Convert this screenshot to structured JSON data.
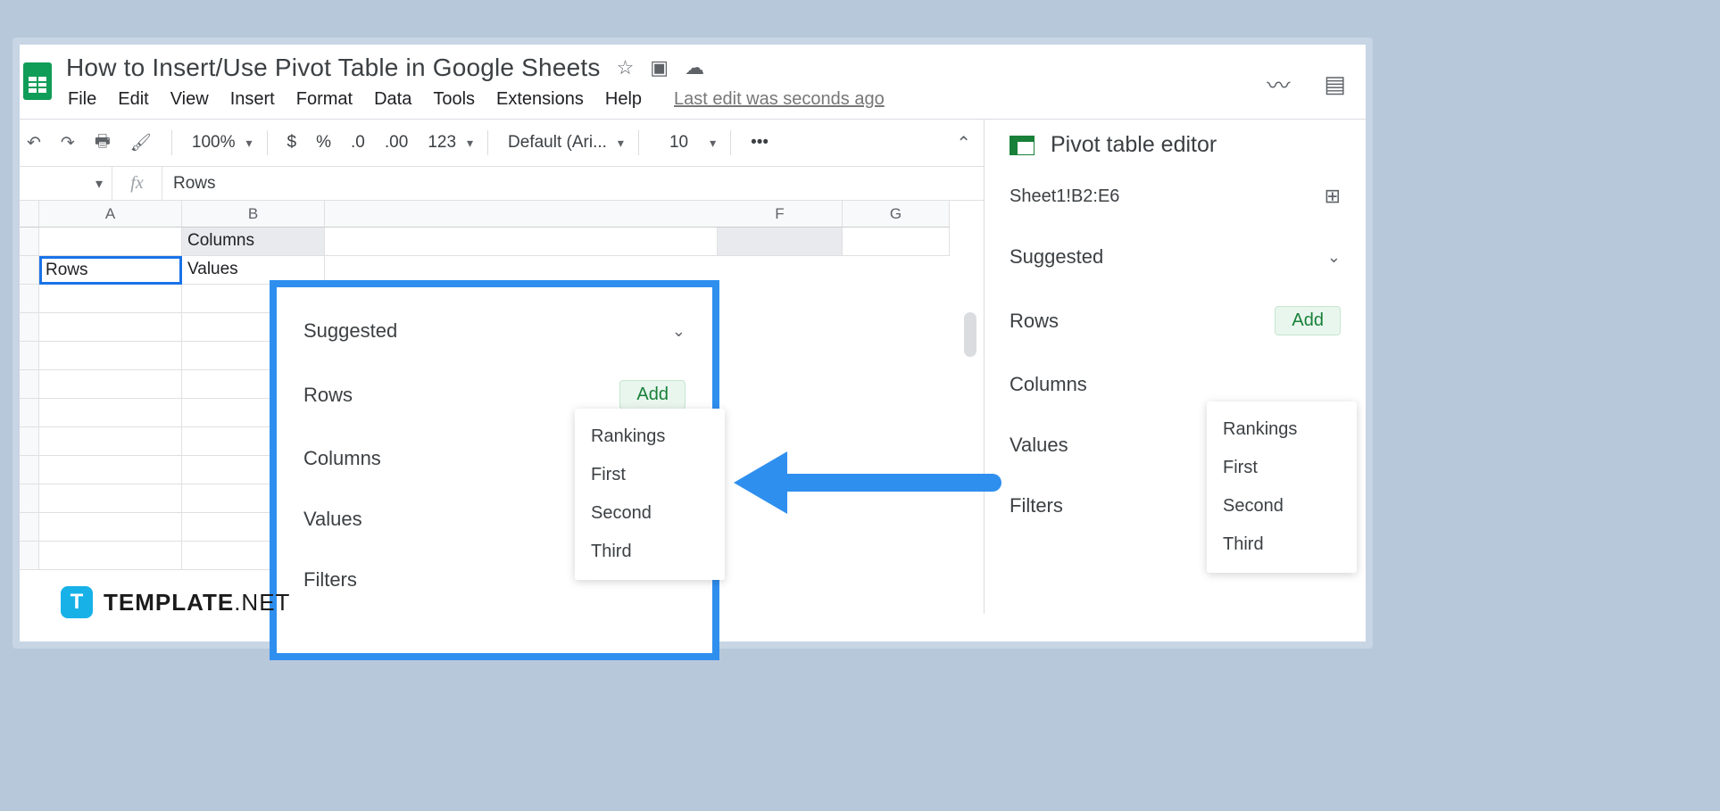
{
  "doc": {
    "title": "How to Insert/Use Pivot Table in Google Sheets",
    "last_edit": "Last edit was seconds ago"
  },
  "menus": [
    "File",
    "Edit",
    "View",
    "Insert",
    "Format",
    "Data",
    "Tools",
    "Extensions",
    "Help"
  ],
  "toolbar": {
    "zoom": "100%",
    "currency": "$",
    "percent": "%",
    "dec_less": ".0",
    "dec_more": ".00",
    "numfmt": "123",
    "font": "Default (Ari...",
    "font_size": "10",
    "more": "•••"
  },
  "formula_bar": {
    "fx": "fx",
    "value": "Rows"
  },
  "columns": [
    "A",
    "B",
    "F",
    "G"
  ],
  "cells": {
    "b1": "Columns",
    "a2": "Rows",
    "b2": "Values"
  },
  "callout": {
    "suggested": "Suggested",
    "rows": "Rows",
    "columns": "Columns",
    "values": "Values",
    "filters": "Filters",
    "add": "Add"
  },
  "dropdown_items": [
    "Rankings",
    "First",
    "Second",
    "Third"
  ],
  "sidebar": {
    "title": "Pivot table editor",
    "range": "Sheet1!B2:E6",
    "suggested": "Suggested",
    "rows": "Rows",
    "columns": "Columns",
    "values": "Values",
    "filters": "Filters",
    "add": "Add"
  },
  "watermark": {
    "logo_letter": "T",
    "brand": "TEMPLATE",
    "ext": ".NET"
  }
}
